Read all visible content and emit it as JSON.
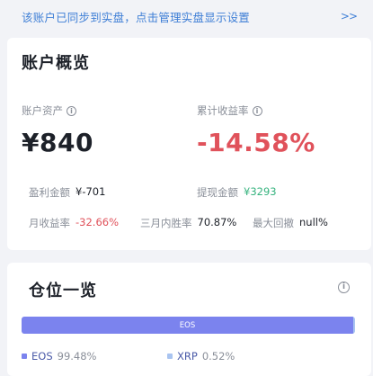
{
  "banner": {
    "text": "该账户已同步到实盘，点击管理实盘显示设置",
    "arrow": ">>"
  },
  "overview": {
    "title": "账户概览",
    "assets_label": "账户资产",
    "assets_value": "¥840",
    "return_label": "累计收益率",
    "return_value": "-14.58%",
    "profit_label": "盈利金额",
    "profit_value": "¥-701",
    "withdraw_label": "提现金额",
    "withdraw_value": "¥3293",
    "monthly_label": "月收益率",
    "monthly_value": "-32.66%",
    "winrate_label": "三月内胜率",
    "winrate_value": "70.87%",
    "drawdown_label": "最大回撤",
    "drawdown_value": "null%"
  },
  "positions": {
    "title": "仓位一览",
    "bar_label": "EOS",
    "items": [
      {
        "name": "EOS",
        "percent_text": "99.48%",
        "percent": 99.48,
        "color": "#7b83ee"
      },
      {
        "name": "XRP",
        "percent_text": "0.52%",
        "percent": 0.52,
        "color": "#a9c4f0"
      }
    ]
  },
  "colors": {
    "accent_blue": "#3f7fd6",
    "negative_red": "#e0525b",
    "positive_green": "#36b37e"
  },
  "icons": [
    "info-icon",
    "double-chevron-right-icon"
  ]
}
